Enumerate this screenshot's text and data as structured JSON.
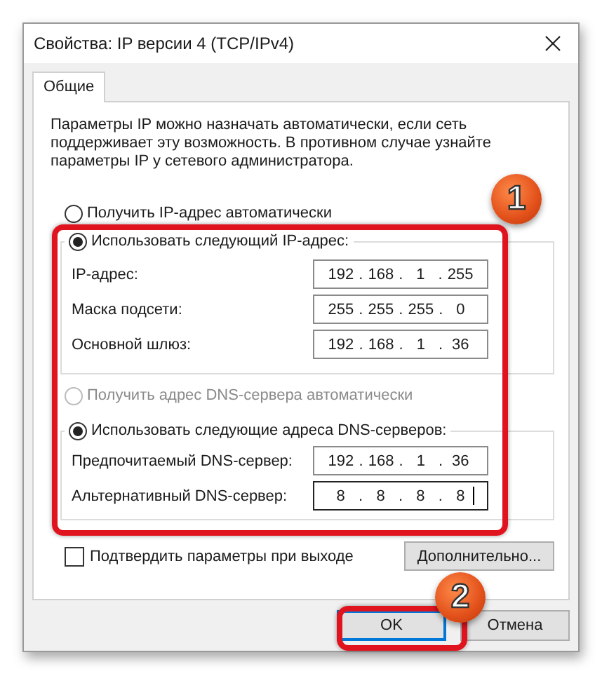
{
  "window": {
    "title": "Свойства: IP версии 4 (TCP/IPv4)"
  },
  "tabs": [
    {
      "label": "Общие",
      "selected": true
    }
  ],
  "description": "Параметры IP можно назначать автоматически, если сеть поддерживает эту возможность. В противном случае узнайте параметры IP у сетевого администратора.",
  "ip_auto": {
    "label": "Получить IP-адрес автоматически",
    "selected": false,
    "disabled": false
  },
  "ip_manual": {
    "label": "Использовать следующий IP-адрес:",
    "selected": true,
    "disabled": false,
    "fields": [
      {
        "label": "IP-адрес:",
        "octets": [
          "192",
          "168",
          "1",
          "255"
        ],
        "focused": false
      },
      {
        "label": "Маска подсети:",
        "octets": [
          "255",
          "255",
          "255",
          "0"
        ],
        "focused": false
      },
      {
        "label": "Основной шлюз:",
        "octets": [
          "192",
          "168",
          "1",
          "36"
        ],
        "focused": false
      }
    ]
  },
  "dns_auto": {
    "label": "Получить адрес DNS-сервера автоматически",
    "selected": false,
    "disabled": true
  },
  "dns_manual": {
    "label": "Использовать следующие адреса DNS-серверов:",
    "selected": true,
    "disabled": false,
    "fields": [
      {
        "label": "Предпочитаемый DNS-сервер:",
        "octets": [
          "192",
          "168",
          "1",
          "36"
        ],
        "focused": false
      },
      {
        "label": "Альтернативный DNS-сервер:",
        "octets": [
          "8",
          "8",
          "8",
          "8"
        ],
        "focused": true
      }
    ]
  },
  "separator": ".",
  "validate_checkbox": {
    "label": "Подтвердить параметры при выходе",
    "checked": false
  },
  "advanced_button": {
    "label": "Дополнительно..."
  },
  "buttons": [
    {
      "label": "OK",
      "focused": true
    },
    {
      "label": "Отмена",
      "focused": false
    }
  ],
  "annotations": [
    {
      "number": "1"
    },
    {
      "number": "2"
    }
  ]
}
